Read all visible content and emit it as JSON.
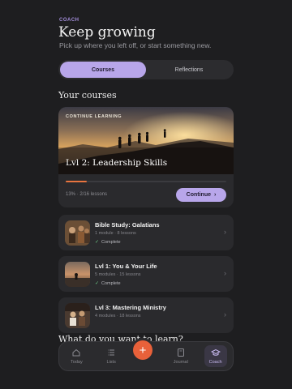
{
  "header": {
    "eyebrow": "COACH",
    "title": "Keep growing",
    "subtitle": "Pick up where you left off, or start something new."
  },
  "segmented": {
    "tabs": [
      {
        "label": "Courses",
        "active": true
      },
      {
        "label": "Reflections",
        "active": false
      }
    ]
  },
  "courses_section": {
    "heading": "Your courses"
  },
  "continue_card": {
    "tag": "CONTINUE LEARNING",
    "title": "Lvl 2: Leadership Skills",
    "progress_text": "13% · 2/16 lessons",
    "progress_fraction": 0.13,
    "cta_label": "Continue",
    "cta_icon": "chevron-right-icon",
    "accent_color": "#e8743f"
  },
  "course_list": [
    {
      "title": "Bible Study: Galatians",
      "meta": "1 module · 8 lessons",
      "status": "Complete"
    },
    {
      "title": "Lvl 1: You & Your Life",
      "meta": "5 modules · 15 lessons",
      "status": "Complete"
    },
    {
      "title": "Lvl 3: Mastering Ministry",
      "meta": "4 modules · 18 lessons",
      "status": ""
    }
  ],
  "learn_section": {
    "heading": "What do you want to learn?"
  },
  "tabbar": {
    "tabs": [
      {
        "label": "Today",
        "icon": "home-icon"
      },
      {
        "label": "Lists",
        "icon": "list-icon"
      },
      {
        "label": "Journal",
        "icon": "journal-icon"
      },
      {
        "label": "Coach",
        "icon": "graduation-cap-icon",
        "active": true
      }
    ],
    "fab_icon": "plus-icon",
    "fab_label": "+",
    "fab_color": "#e8613a"
  },
  "colors": {
    "accent": "#b8a6ea",
    "background": "#1e1e20",
    "card": "#2a2a2d"
  }
}
